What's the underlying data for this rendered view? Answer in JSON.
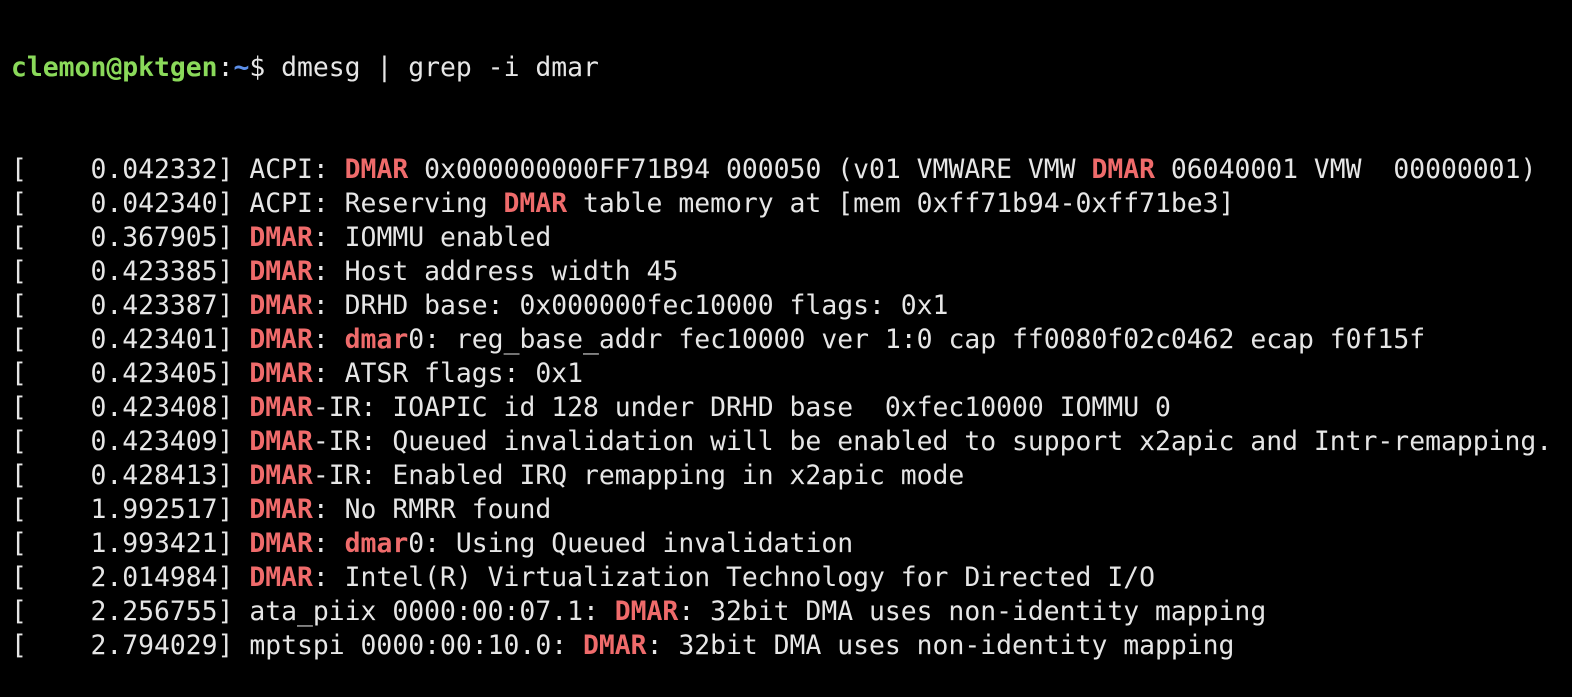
{
  "terminal": {
    "prompt": {
      "user_host": "clemon@pktgen",
      "separator": ":",
      "path": "~",
      "symbol": "$ ",
      "command": "dmesg | grep -i dmar"
    },
    "highlight_color": "#ef6b6b",
    "lines": [
      [
        "[    0.042332] ACPI: ",
        "DMAR",
        " 0x000000000FF71B94 000050 (v01 VMWARE VMW ",
        "DMAR",
        " 06040001 VMW  00000001)"
      ],
      [
        "[    0.042340] ACPI: Reserving ",
        "DMAR",
        " table memory at [mem 0xff71b94-0xff71be3]"
      ],
      [
        "[    0.367905] ",
        "DMAR",
        ": IOMMU enabled"
      ],
      [
        "[    0.423385] ",
        "DMAR",
        ": Host address width 45"
      ],
      [
        "[    0.423387] ",
        "DMAR",
        ": DRHD base: 0x000000fec10000 flags: 0x1"
      ],
      [
        "[    0.423401] ",
        "DMAR",
        ": ",
        "dmar",
        "0: reg_base_addr fec10000 ver 1:0 cap ff0080f02c0462 ecap f0f15f"
      ],
      [
        "[    0.423405] ",
        "DMAR",
        ": ATSR flags: 0x1"
      ],
      [
        "[    0.423408] ",
        "DMAR",
        "-IR: IOAPIC id 128 under DRHD base  0xfec10000 IOMMU 0"
      ],
      [
        "[    0.423409] ",
        "DMAR",
        "-IR: Queued invalidation will be enabled to support x2apic and Intr-remapping."
      ],
      [
        "[    0.428413] ",
        "DMAR",
        "-IR: Enabled IRQ remapping in x2apic mode"
      ],
      [
        "[    1.992517] ",
        "DMAR",
        ": No RMRR found"
      ],
      [
        "[    1.993421] ",
        "DMAR",
        ": ",
        "dmar",
        "0: Using Queued invalidation"
      ],
      [
        "[    2.014984] ",
        "DMAR",
        ": Intel(R) Virtualization Technology for Directed I/O"
      ],
      [
        "[    2.256755] ata_piix 0000:00:07.1: ",
        "DMAR",
        ": 32bit DMA uses non-identity mapping"
      ],
      [
        "[    2.794029] mptspi 0000:00:10.0: ",
        "DMAR",
        ": 32bit DMA uses non-identity mapping"
      ]
    ]
  }
}
